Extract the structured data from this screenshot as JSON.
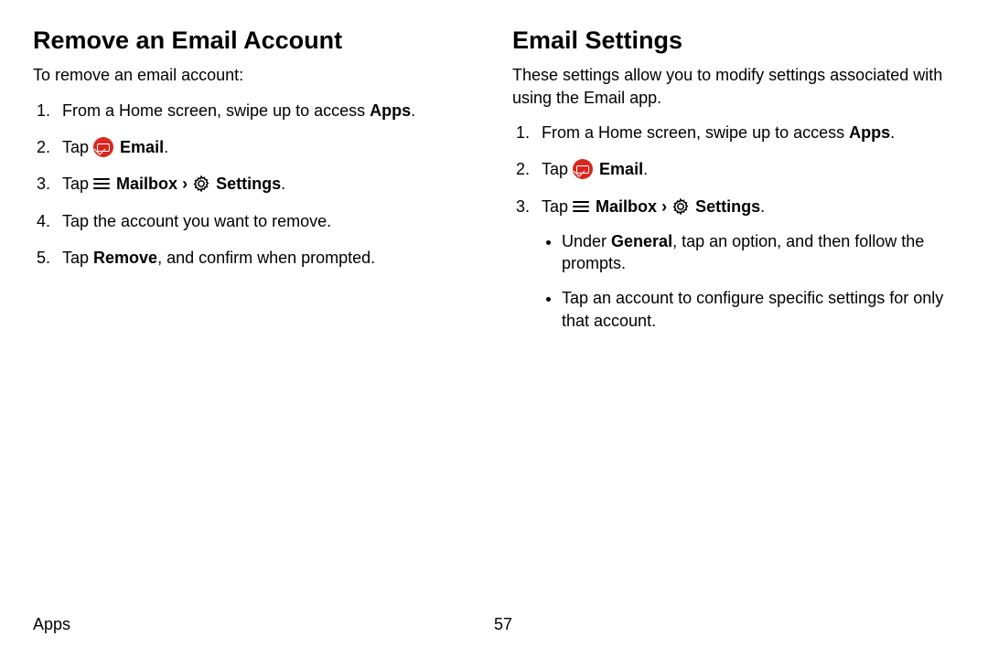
{
  "left": {
    "heading": "Remove an Email Account",
    "intro": "To remove an email account:",
    "step1_pre": "From a Home screen, swipe up to access ",
    "step1_b": "Apps",
    "step1_post": ".",
    "step2_pre": "Tap ",
    "step2_b": "Email",
    "step2_post": ".",
    "step3_pre": "Tap ",
    "step3_b1": "Mailbox",
    "step3_mid": " ",
    "step3_chev": "›",
    "step3_sp": " ",
    "step3_b2": "Settings",
    "step3_post": ".",
    "step4": "Tap the account you want to remove.",
    "step5_pre": "Tap ",
    "step5_b": "Remove",
    "step5_post": ", and confirm when prompted."
  },
  "right": {
    "heading": "Email Settings",
    "intro": "These settings allow you to modify settings associated with using the Email app.",
    "step1_pre": "From a Home screen, swipe up to access ",
    "step1_b": "Apps",
    "step1_post": ".",
    "step2_pre": "Tap ",
    "step2_b": "Email",
    "step2_post": ".",
    "step3_pre": "Tap ",
    "step3_b1": "Mailbox",
    "step3_mid": " ",
    "step3_chev": "›",
    "step3_sp": " ",
    "step3_b2": "Settings",
    "step3_post": ".",
    "sub1_pre": "Under ",
    "sub1_b": "General",
    "sub1_post": ", tap an option, and then follow the prompts.",
    "sub2": "Tap an account to configure specific settings for only that account."
  },
  "footer": {
    "section": "Apps",
    "page": "57"
  }
}
